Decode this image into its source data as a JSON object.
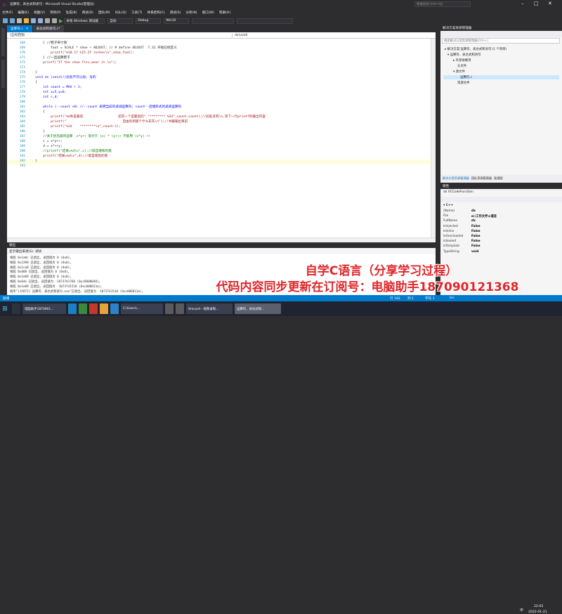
{
  "window": {
    "title": "运算符、表达式和语句 - Microsoft Visual Studio(管理员)",
    "quick_launch": "快速启动 (Ctrl+Q)"
  },
  "menu": [
    "文件(F)",
    "编辑(E)",
    "视图(V)",
    "项目(P)",
    "生成(B)",
    "调试(D)",
    "团队(M)",
    "SQL(Q)",
    "工具(T)",
    "体系结构(C)",
    "测试(S)",
    "分析(N)",
    "窗口(W)",
    "帮助(H)"
  ],
  "toolbar": {
    "debugger_label": "本地 Windows 调试器",
    "auto_label": "自动",
    "config": "Debug",
    "platform": "Win32"
  },
  "doc_tabs": [
    {
      "label": "运算符.c",
      "active": true
    },
    {
      "label": "表达式和语句.c*",
      "active": false
    }
  ],
  "navbar": {
    "scope": "(全局范围)",
    "function": "dx(void)"
  },
  "editor": {
    "lines": [
      {
        "num": "168",
        "text": "    { //鞋子英寸值"
      },
      {
        "num": "169",
        "text": "        foot = SCALE * shoe + ADJUST; // # define ADJUST  7.31 开始已经定义"
      },
      {
        "num": "170",
        "text": "        printf(\"%10.1f %15.2f inches\\n\",shoe,foot);"
      },
      {
        "num": "171",
        "text": "    } //一直运算鞋子"
      },
      {
        "num": "172",
        "text": "    printf(\"If the shoe fits,wear it.\\n\");"
      },
      {
        "num": "173",
        "text": ""
      },
      {
        "num": "174",
        "text": "}"
      },
      {
        "num": "175",
        "text": "void dx (void)//此处不可以加; 号的"
      },
      {
        "num": "176",
        "text": "{"
      },
      {
        "num": "177",
        "text": "    int count = MAX + 1;"
      },
      {
        "num": "178",
        "text": "    int x=5,y=6;"
      },
      {
        "num": "179",
        "text": "    int c,d;"
      },
      {
        "num": "180",
        "text": ""
      },
      {
        "num": "181",
        "text": "    while (--count >0) //--count 表明当前的递减运算符; count--后缀形式的递减运算符"
      },
      {
        "num": "182",
        "text": "    {"
      },
      {
        "num": "183",
        "text": "        printf(\"%d条是最后                  还有一个是最后的\" \"******** %2d\",count,count);//此处没有\\n,等下一行printf的输出内容"
      },
      {
        "num": "184",
        "text": "        printf(\"                             自由的到底个什么东东\\n\");//书籍输出目前"
      },
      {
        "num": "185",
        "text": "        printf(\"%2d    ********\\n\",count-1);"
      },
      {
        "num": "186",
        "text": "    }"
      },
      {
        "num": "187",
        "text": "    //关于优先级的运算  x*y++ 等价于 (x) * (y++) 不能用 (x*y) ++"
      },
      {
        "num": "188",
        "text": "    c = x*y++;"
      },
      {
        "num": "189",
        "text": "    d = x*++y;"
      },
      {
        "num": "190",
        "text": "    //printf(\"结果=%d\\n\",c);//取自增和的值"
      },
      {
        "num": "191",
        "text": "    printf(\"结果=%d\\n\",d);//取自增后的值"
      },
      {
        "num": "192",
        "text": "}"
      },
      {
        "num": "193",
        "text": ""
      }
    ]
  },
  "output": {
    "header": "显示输出来源(S): 调试",
    "lines": [
      "线程 0x1a0c 已退出, 返回值为 0 (0x0)。",
      "线程 0x2390 已退出, 返回值为 0 (0x0)。",
      "线程 0x1ca8 已退出, 返回值为 0 (0x0)。",
      "线程 0x808 已退出, 返回值为 0 (0x0)。",
      "线程 0x1e09 已退出, 返回值为 0 (0x0)。",
      "线程 0x64e 已退出, 返回值为 -1073741760 (0xc0000040)。",
      "线程 0x1e09 已退出, 返回值为 -1073741510 (0xc000013a)。",
      "程序\"[15872] 运算符、表达式和语句.exe\"已退出, 返回值为 -1073741510 (0xc000013a)。"
    ]
  },
  "solution_explorer": {
    "title": "解决方案资源管理器",
    "search_placeholder": "搜索解决方案资源管理器(Ctrl+;)",
    "items": [
      "解决方案'运算符、表达式和语句'(1 个项目)",
      "运算符、表达式和语句",
      "外部依赖项",
      "头文件",
      "源文件",
      "运算符.c",
      "资源文件"
    ],
    "bottom_tabs": [
      "解决方案资源管理器",
      "团队资源管理器",
      "类视图"
    ]
  },
  "properties": {
    "title": "属性",
    "object": "dx VCCodeFunction",
    "section": "C++",
    "rows": [
      {
        "k": "(Name)",
        "v": "dx"
      },
      {
        "k": "File",
        "v": "e:\\工作文件\\c语言"
      },
      {
        "k": "FullName",
        "v": "dx"
      },
      {
        "k": "IsInjected",
        "v": "False"
      },
      {
        "k": "IsInline",
        "v": "False"
      },
      {
        "k": "IsOverloaded",
        "v": "False"
      },
      {
        "k": "IsSealed",
        "v": "False"
      },
      {
        "k": "IsTemplate",
        "v": "False"
      },
      {
        "k": "TypeString",
        "v": "void"
      }
    ]
  },
  "status": {
    "left": "就绪",
    "row": "行 192",
    "col": "列 1",
    "ch": "字符 1",
    "ins": "Ins"
  },
  "taskbar": {
    "items": [
      "电脑助手1870901...",
      "",
      "",
      "",
      "",
      "",
      "",
      "C:\\Users\\...",
      "",
      "",
      "",
      "",
      "",
      "",
      "Xrecord - 视频录制...",
      "运算符、表达式和...",
      ""
    ],
    "time": "22:05",
    "date": "2022-01-21",
    "lang": "中"
  },
  "overlay": {
    "line1": "自学C语言（分享学习过程）",
    "line2": "代码内容同步更新在订阅号：电脑助手18709012136​8"
  },
  "colors": {
    "accent": "#007acc",
    "overlay_text": "#e0262a",
    "keyword": "#0000ff",
    "comment": "#008000",
    "string": "#a31515"
  }
}
